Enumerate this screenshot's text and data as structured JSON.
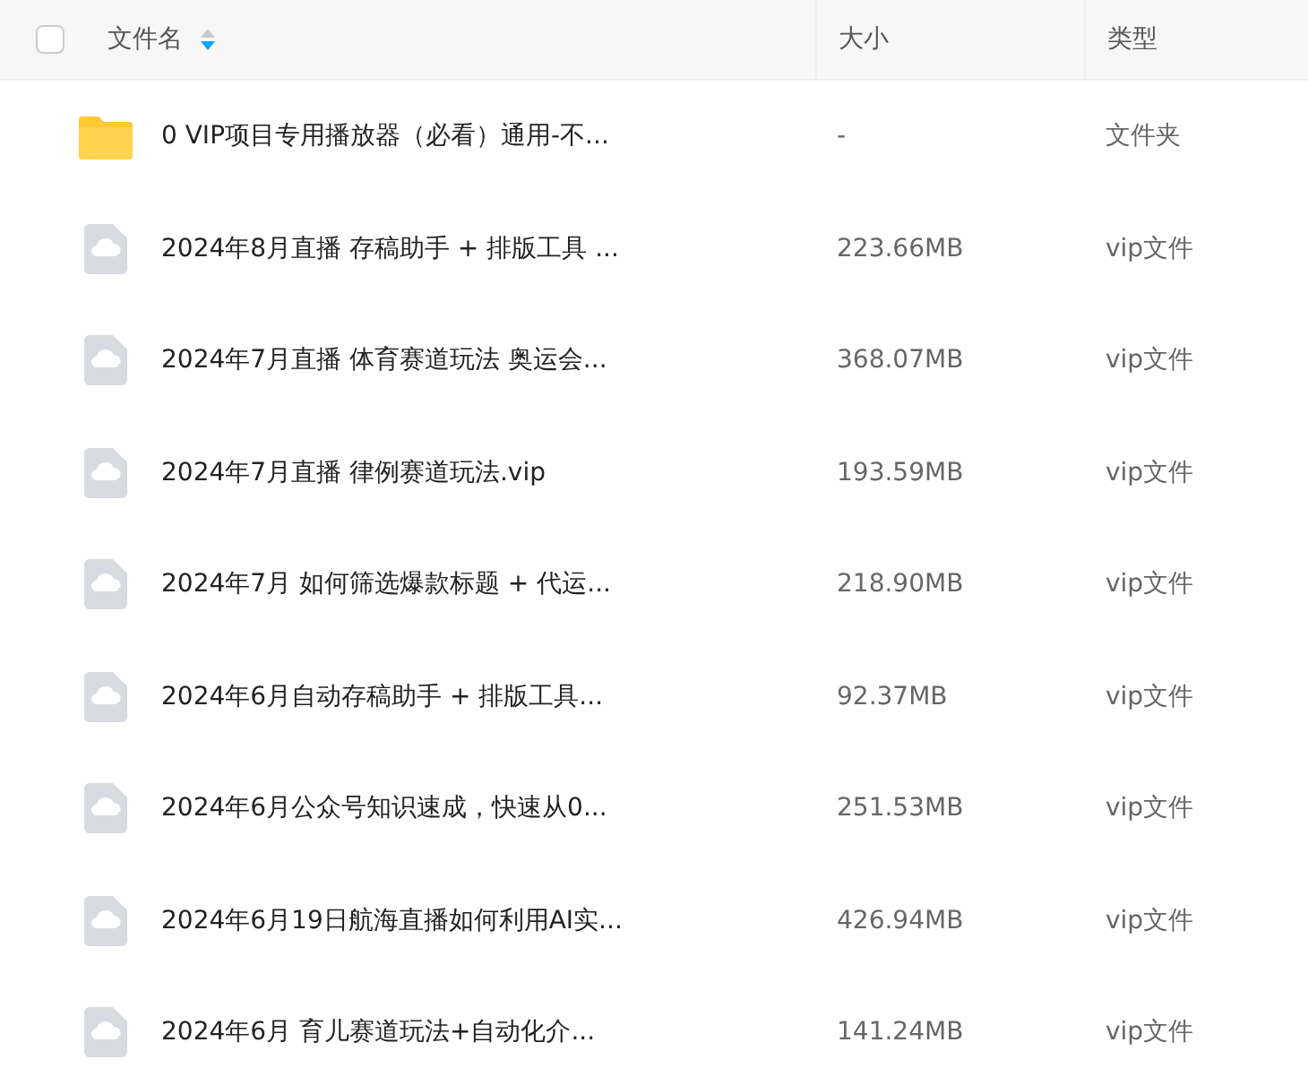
{
  "table": {
    "select_all": {
      "checked": false
    },
    "columns": [
      {
        "label": "文件名",
        "sorted_descending": true
      },
      {
        "label": "大小"
      },
      {
        "label": "类型"
      }
    ],
    "rows": [
      {
        "kind": "folder",
        "name": "0 VIP项目专用播放器（必看）通用-不...",
        "size": "-",
        "type": "文件夹"
      },
      {
        "kind": "file",
        "name": "2024年8月直播 存稿助手 + 排版工具 ...",
        "size": "223.66MB",
        "type": "vip文件"
      },
      {
        "kind": "file",
        "name": "2024年7月直播 体育赛道玩法 奥运会...",
        "size": "368.07MB",
        "type": "vip文件"
      },
      {
        "kind": "file",
        "name": "2024年7月直播 律例赛道玩法.vip",
        "size": "193.59MB",
        "type": "vip文件"
      },
      {
        "kind": "file",
        "name": "2024年7月 如何筛选爆款标题 + 代运...",
        "size": "218.90MB",
        "type": "vip文件"
      },
      {
        "kind": "file",
        "name": "2024年6月自动存稿助手 + 排版工具...",
        "size": "92.37MB",
        "type": "vip文件"
      },
      {
        "kind": "file",
        "name": "2024年6月公众号知识速成，快速从0...",
        "size": "251.53MB",
        "type": "vip文件"
      },
      {
        "kind": "file",
        "name": "2024年6月19日航海直播如何利用AI实...",
        "size": "426.94MB",
        "type": "vip文件"
      },
      {
        "kind": "file",
        "name": "2024年6月 育儿赛道玩法+自动化介...",
        "size": "141.24MB",
        "type": "vip文件"
      }
    ]
  }
}
